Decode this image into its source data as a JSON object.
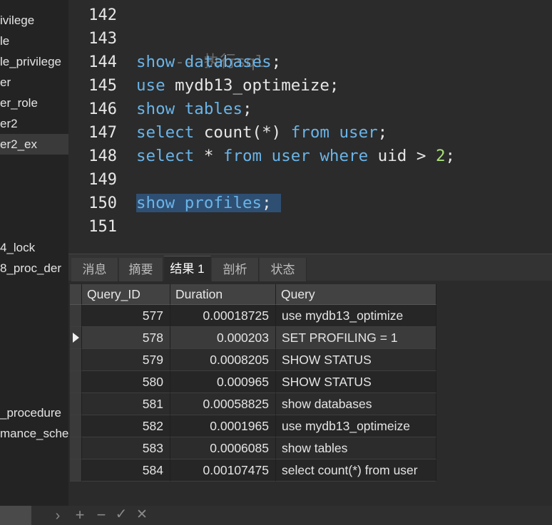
{
  "sidebar": {
    "items": [
      {
        "label": "ivilege"
      },
      {
        "label": "le"
      },
      {
        "label": "le_privilege"
      },
      {
        "label": "er"
      },
      {
        "label": "er_role"
      },
      {
        "label": "er2"
      },
      {
        "label": "er2_ex"
      },
      {
        "label": "4_lock"
      },
      {
        "label": "8_proc_der"
      },
      {
        "label": "_procedure"
      },
      {
        "label": "mance_sche"
      }
    ]
  },
  "editor": {
    "line_numbers": [
      "142",
      "143",
      "144",
      "145",
      "146",
      "147",
      "148",
      "149",
      "150",
      "151"
    ],
    "line_143_comment": "-- 执行sql",
    "line_144_kw1": "show",
    "line_144_kw2": "databases",
    "line_144_rest": ";",
    "line_145_kw": "use",
    "line_145_rest": " mydb13_optimeize;",
    "line_146_kw1": "show",
    "line_146_kw2": "tables",
    "line_146_rest": ";",
    "line_147_kw1": "select",
    "line_147_mid": " count(*) ",
    "line_147_kw2": "from",
    "line_147_kw3": "user",
    "line_147_rest": ";",
    "line_148_kw1": "select",
    "line_148_mid1": " * ",
    "line_148_kw2": "from",
    "line_148_kw3": "user",
    "line_148_kw4": "where",
    "line_148_mid2": " uid > ",
    "line_148_num": "2",
    "line_148_rest": ";",
    "line_150_kw1": "show",
    "line_150_kw2": "profiles",
    "line_150_rest": ";"
  },
  "result_tabs": [
    {
      "label": "消息"
    },
    {
      "label": "摘要"
    },
    {
      "label": "结果 1"
    },
    {
      "label": "剖析"
    },
    {
      "label": "状态"
    }
  ],
  "grid": {
    "headers": {
      "query_id": "Query_ID",
      "duration": "Duration",
      "query": "Query"
    },
    "rows": [
      {
        "query_id": "577",
        "duration": "0.00018725",
        "query": "use mydb13_optimize"
      },
      {
        "query_id": "578",
        "duration": "0.000203",
        "query": "SET PROFILING = 1"
      },
      {
        "query_id": "579",
        "duration": "0.0008205",
        "query": "SHOW STATUS"
      },
      {
        "query_id": "580",
        "duration": "0.000965",
        "query": "SHOW STATUS"
      },
      {
        "query_id": "581",
        "duration": "0.00058825",
        "query": "show databases"
      },
      {
        "query_id": "582",
        "duration": "0.0001965",
        "query": "use mydb13_optimeize"
      },
      {
        "query_id": "583",
        "duration": "0.0006085",
        "query": "show tables"
      },
      {
        "query_id": "584",
        "duration": "0.00107475",
        "query": "select count(*) from user"
      }
    ]
  },
  "toolbar": {
    "nav_icon": "›",
    "add_icon": "+",
    "remove_icon": "−",
    "apply_icon": "✓",
    "cancel_icon": "✕"
  },
  "colors": {
    "keyword": "#6ab4e8",
    "number": "#a8e07a",
    "comment": "#6a6a6a",
    "selection": "#2f4f72"
  }
}
